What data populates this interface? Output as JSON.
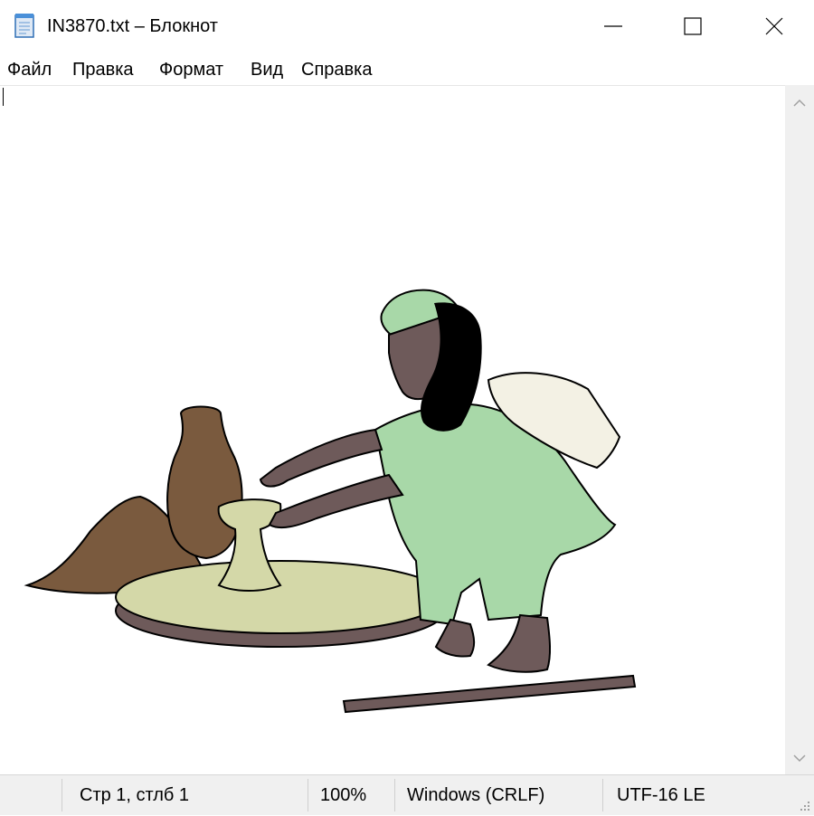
{
  "window": {
    "title": "IN3870.txt – Блокнот",
    "app_icon": "notepad-icon",
    "controls": [
      "minimize-icon",
      "maximize-icon",
      "close-icon"
    ]
  },
  "menu": {
    "file": "Файл",
    "edit": "Правка",
    "format": "Формат",
    "view": "Вид",
    "help": "Справка"
  },
  "editor": {
    "content_image": "potter-at-wheel-illustration"
  },
  "scrollbar": {
    "up_icon": "chevron-up-icon",
    "down_icon": "chevron-down-icon"
  },
  "status": {
    "position": "Стр 1, стлб 1",
    "zoom": "100%",
    "line_endings": "Windows (CRLF)",
    "encoding": "UTF-16 LE"
  }
}
